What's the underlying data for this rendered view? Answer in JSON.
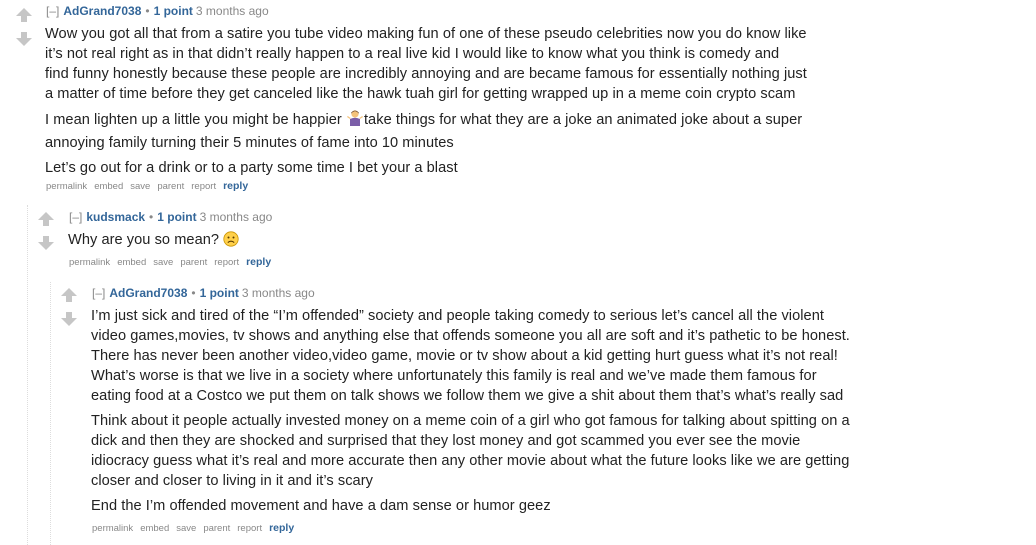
{
  "comments": [
    {
      "collapse": "[–]",
      "author": "AdGrand7038",
      "score": "1 point",
      "time": "3 months ago",
      "paragraphs": [
        [
          "Wow you got all that from a satire you tube video making fun of one of these pseudo celebrities now you do know like",
          "it’s not real right as in that didn’t really happen to a real live kid I would like to know what you think is comedy and",
          "find funny honestly because these people are incredibly annoying and are became famous for essentially nothing just",
          "a matter of time before they get canceled like the hawk tuah girl for getting wrapped up in a meme coin crypto scam"
        ],
        [
          "I mean lighten up a little you might be happier ",
          "take things for what they are a joke an animated joke about a super",
          "annoying family turning their 5 minutes of fame into 10 minutes"
        ],
        [
          "Let’s go out for a drink or to a party some time I bet your a blast"
        ]
      ],
      "emoji_icon": "person-shrugging-icon"
    },
    {
      "collapse": "[–]",
      "author": "kudsmack",
      "score": "1 point",
      "time": "3 months ago",
      "text": "Why are you so mean? ",
      "emoji_icon": "sad-face-icon"
    },
    {
      "collapse": "[–]",
      "author": "AdGrand7038",
      "score": "1 point",
      "time": "3 months ago",
      "paragraphs": [
        [
          "I’m just sick and tired of the “I’m offended” society and people taking comedy to serious let’s cancel all the violent",
          "video games,movies, tv shows and anything else that offends someone you all are soft and it’s pathetic to be honest.",
          "There has never been another video,video game, movie or tv show about a kid getting hurt guess what it’s not real!",
          "What’s worse is that we live in a society where unfortunately this family is real and we’ve made them famous for",
          "eating food at a Costco we put them on talk shows we follow them we give a shit about them that’s what’s really sad"
        ],
        [
          "Think about it people actually invested money on a meme coin of a girl who got famous for talking about spitting on a",
          "dick and then they are shocked and surprised that they lost money and got scammed you ever see the movie",
          "idiocracy guess what it’s real and more accurate then any other movie about what the future looks like we are getting",
          "closer and closer to living in it and it’s scary"
        ],
        [
          "End the I’m offended movement and have a dam sense or humor geez"
        ]
      ]
    }
  ],
  "buttons": {
    "permalink": "permalink",
    "embed": "embed",
    "save": "save",
    "parent": "parent",
    "report": "report",
    "reply": "reply"
  },
  "colors": {
    "author": "#336699",
    "muted": "#888888",
    "text": "#222222",
    "arrow": "#c6c6c6"
  }
}
